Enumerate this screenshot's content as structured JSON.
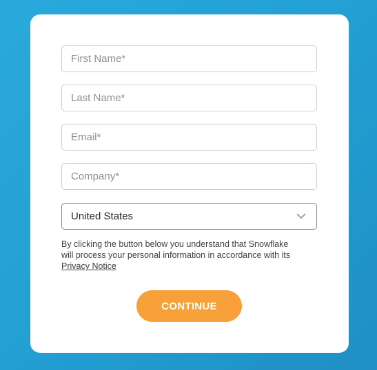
{
  "form": {
    "first_name": {
      "placeholder": "First Name*",
      "value": ""
    },
    "last_name": {
      "placeholder": "Last Name*",
      "value": ""
    },
    "email": {
      "placeholder": "Email*",
      "value": ""
    },
    "company": {
      "placeholder": "Company*",
      "value": ""
    },
    "country": {
      "selected": "United States"
    },
    "consent_text": "By clicking the button below you understand that Snowflake will process your personal information in accordance with its ",
    "privacy_link": "Privacy Notice",
    "continue_label": "CONTINUE"
  },
  "colors": {
    "background": "#239fd3",
    "card": "#ffffff",
    "button": "#f8a13a",
    "select_border": "#2bb3a6"
  },
  "icons": {
    "select_chevron": "chevron-down-icon"
  }
}
